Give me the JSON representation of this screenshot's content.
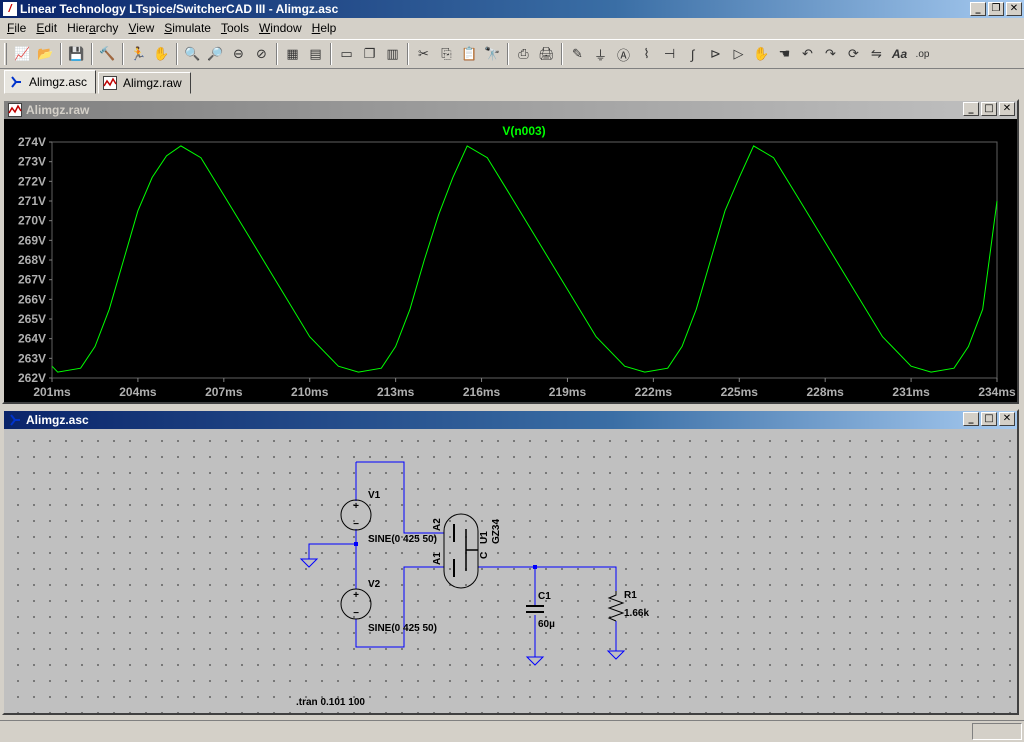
{
  "window": {
    "title": "Linear Technology LTspice/SwitcherCAD III - Alimgz.asc",
    "app_icon": "ltspice-logo-icon"
  },
  "menu": [
    {
      "label": "File",
      "accel": "F"
    },
    {
      "label": "Edit",
      "accel": "E"
    },
    {
      "label": "Hierarchy",
      "accel": "a"
    },
    {
      "label": "View",
      "accel": "V"
    },
    {
      "label": "Simulate",
      "accel": "S"
    },
    {
      "label": "Tools",
      "accel": "T"
    },
    {
      "label": "Window",
      "accel": "W"
    },
    {
      "label": "Help",
      "accel": "H"
    }
  ],
  "toolbar": [
    "new-schematic-icon",
    "open-icon",
    "|",
    "save-icon",
    "|",
    "control-panel-icon",
    "|",
    "run-icon",
    "pan-icon",
    "|",
    "zoom-in-icon",
    "zoom-rect-icon",
    "zoom-out-icon",
    "zoom-cancel-icon",
    "|",
    "autorange-icon",
    "grid-icon",
    "|",
    "tile-horizontal-icon",
    "cascade-icon",
    "tile-vertical-icon",
    "|",
    "cut-icon",
    "copy-icon",
    "paste-icon",
    "find-icon",
    "|",
    "print-preview-icon",
    "print-icon",
    "|",
    "wire-icon",
    "ground-icon",
    "label-icon",
    "resistor-icon",
    "capacitor-icon",
    "inductor-icon",
    "diode-icon",
    "component-icon",
    "move-icon",
    "drag-icon",
    "undo-icon",
    "redo-icon",
    "rotate-icon",
    "mirror-icon",
    "text-icon",
    "spice-directive-icon"
  ],
  "tabs": [
    {
      "label": "Alimgz.asc",
      "icon": "schematic-icon",
      "active": true
    },
    {
      "label": "Alimgz.raw",
      "icon": "waveform-icon",
      "active": false
    }
  ],
  "plot_window": {
    "title": "Alimgz.raw",
    "trace_name": "V(n003)",
    "trace_color": "#00ff00",
    "background": "#000000"
  },
  "chart_data": {
    "type": "line",
    "title": "V(n003)",
    "xlabel": "",
    "ylabel": "",
    "x_ticks": [
      "201ms",
      "204ms",
      "207ms",
      "210ms",
      "213ms",
      "216ms",
      "219ms",
      "222ms",
      "225ms",
      "228ms",
      "231ms",
      "234ms"
    ],
    "y_ticks": [
      "262V",
      "263V",
      "264V",
      "265V",
      "266V",
      "267V",
      "268V",
      "269V",
      "270V",
      "271V",
      "272V",
      "273V",
      "274V"
    ],
    "xlim": [
      201,
      234
    ],
    "ylim": [
      262,
      274
    ],
    "series": [
      {
        "name": "V(n003)",
        "x": [
          201,
          201.2,
          202,
          202.5,
          203,
          203.5,
          204,
          204.5,
          205,
          205.5,
          206.2,
          207,
          208,
          209,
          210,
          211,
          211.7,
          212.5,
          213,
          213.5,
          214,
          214.5,
          215,
          215.5,
          216.2,
          217,
          218,
          219,
          220,
          221,
          221.7,
          222.5,
          223,
          223.5,
          224,
          224.5,
          225,
          225.5,
          226.2,
          227,
          228,
          229,
          230,
          231,
          231.7,
          232.5,
          233,
          233.5,
          234
        ],
        "y": [
          262.6,
          262.3,
          262.5,
          263.6,
          265.5,
          268,
          270.5,
          272.2,
          273.3,
          273.8,
          273.2,
          271.3,
          268.9,
          266.5,
          264.1,
          262.6,
          262.3,
          262.5,
          263.6,
          265.5,
          268,
          270.3,
          272.2,
          273.8,
          273.2,
          271.3,
          268.9,
          266.5,
          264.1,
          262.6,
          262.3,
          262.5,
          263.6,
          265.5,
          268,
          270.5,
          272.2,
          273.8,
          273.2,
          271.3,
          268.9,
          266.5,
          264.1,
          262.6,
          262.3,
          262.5,
          263.6,
          265.5,
          271
        ]
      }
    ],
    "grid": false
  },
  "schematic_window": {
    "title": "Alimgz.asc",
    "wire_color": "#0000ff",
    "labels": {
      "v1_name": "V1",
      "v1_value": "SINE(0 425 50)",
      "v2_name": "V2",
      "v2_value": "SINE(0 425 50)",
      "u1_name": "U1",
      "u1_value": "GZ34",
      "a1": "A1",
      "a2": "A2",
      "c_pin": "C",
      "c1_name": "C1",
      "c1_value": "60µ",
      "r1_name": "R1",
      "r1_value": "1.66k",
      "directive": ".tran 0.101 100",
      "plus": "+",
      "minus": "−"
    }
  }
}
